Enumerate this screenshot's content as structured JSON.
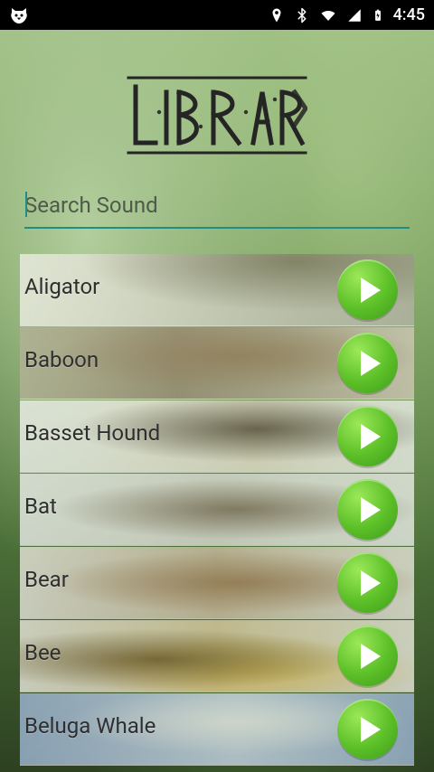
{
  "status_bar": {
    "time": "4:45",
    "icons": [
      "cat-icon",
      "location-icon",
      "bluetooth-icon",
      "wifi-icon",
      "signal-icon",
      "battery-charging-icon"
    ]
  },
  "header": {
    "logo_text": "LIBRARY"
  },
  "search": {
    "placeholder": "Search Sound",
    "value": ""
  },
  "sounds": [
    {
      "label": "Aligator",
      "image": "aligator"
    },
    {
      "label": "Baboon",
      "image": "baboon"
    },
    {
      "label": "Basset Hound",
      "image": "basset-hound"
    },
    {
      "label": "Bat",
      "image": "bat"
    },
    {
      "label": "Bear",
      "image": "bear"
    },
    {
      "label": "Bee",
      "image": "bee"
    },
    {
      "label": "Beluga Whale",
      "image": "beluga-whale"
    }
  ]
}
